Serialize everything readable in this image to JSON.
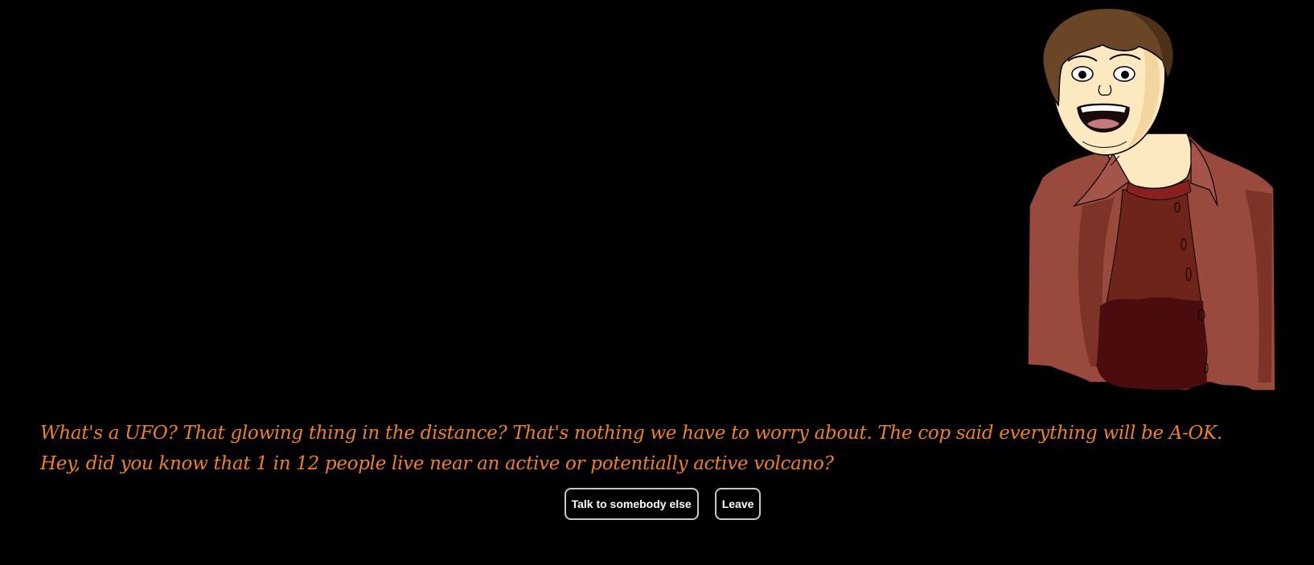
{
  "character": {
    "portrait_icon": "shocked-man-portrait",
    "colors": {
      "skin": "#fde9bf",
      "hair": "#6b4626",
      "jacket": "#9a4a3c",
      "shirt": "#6e2418",
      "shirt_shadow": "#4a0c0c"
    }
  },
  "dialogue": {
    "line1": "What's a UFO? That glowing thing in the distance? That's nothing we have to worry about. The cop said everything will be A-OK.",
    "line2": "Hey, did you know that 1 in 12 people live near an active or potentially active volcano?",
    "text_color": "#f0821e"
  },
  "choices": {
    "talk_label": "Talk to somebody else",
    "leave_label": "Leave"
  }
}
